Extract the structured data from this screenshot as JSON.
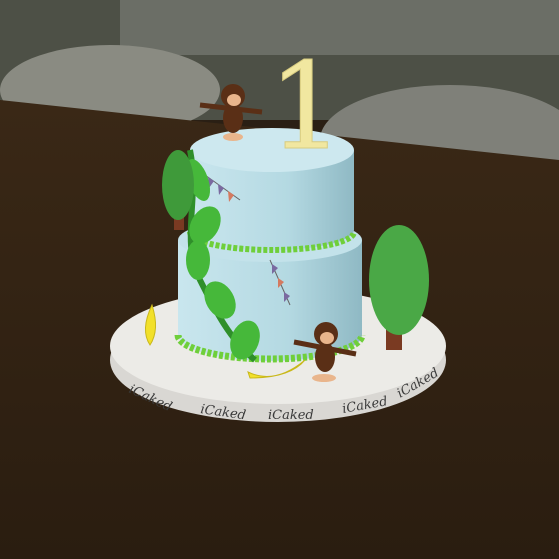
{
  "scene": {
    "subject": "Two-tier first birthday cake with monkeys, jungle vine, bunting and trees",
    "topper_number": "1",
    "board_brand": "iCaked",
    "board_brand_repeats": 5
  },
  "colors": {
    "table": "#3b2a19",
    "frosting": "#b9dde6",
    "board": "#e8e6e2",
    "topper": "#f3eaa3",
    "leaf": "#3fae35",
    "monkey": "#5a2f16",
    "banana": "#f2e02a"
  }
}
